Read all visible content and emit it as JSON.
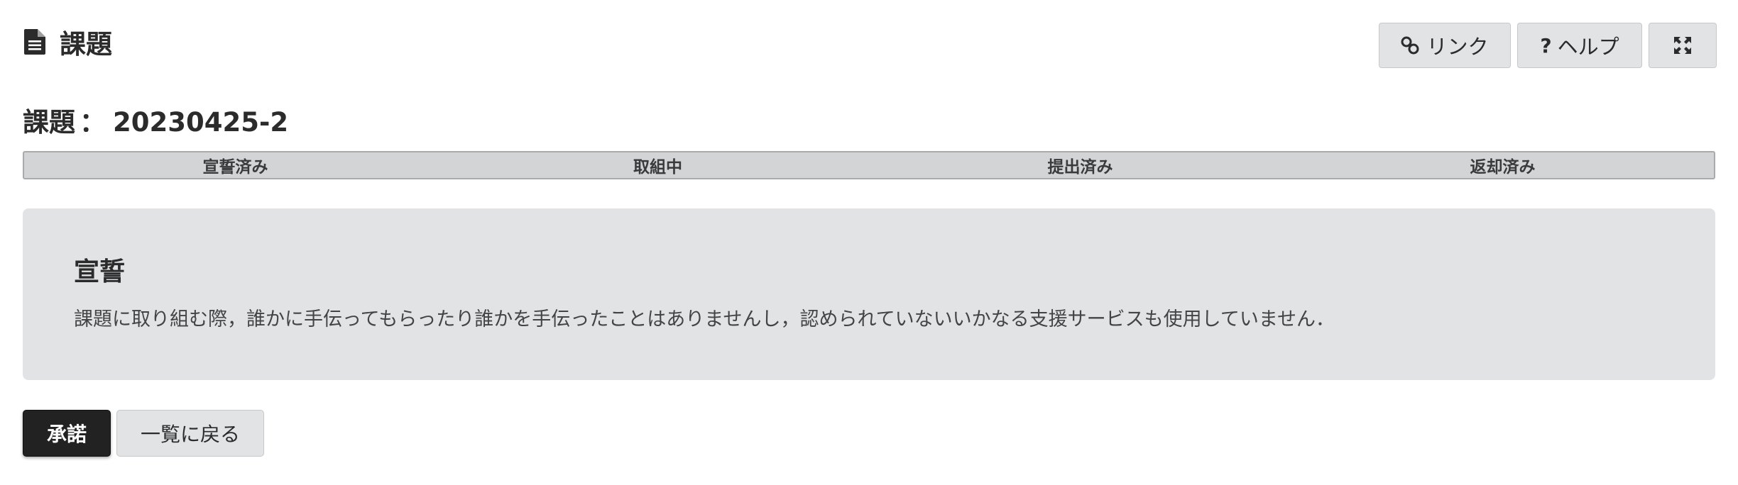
{
  "header": {
    "title": "課題",
    "title_icon": "document-icon",
    "link_label": "リンク",
    "link_icon": "link-icon",
    "help_label": "ヘルプ",
    "help_icon": "question-icon",
    "fullscreen_icon": "expand-icon"
  },
  "task": {
    "label": "課題",
    "separator": "：",
    "id": "20230425-2"
  },
  "progress": {
    "steps": [
      "宣誓済み",
      "取組中",
      "提出済み",
      "返却済み"
    ]
  },
  "pledge": {
    "heading": "宣誓",
    "text": "課題に取り組む際，誰かに手伝ってもらったり誰かを手伝ったことはありませんし，認められていないいかなる支援サービスも使用していません．"
  },
  "actions": {
    "accept_label": "承諾",
    "back_label": "一覧に戻る"
  },
  "colors": {
    "panel_bg": "#e2e3e5",
    "progress_bg": "#d3d4d6",
    "primary_button": "#222222"
  }
}
